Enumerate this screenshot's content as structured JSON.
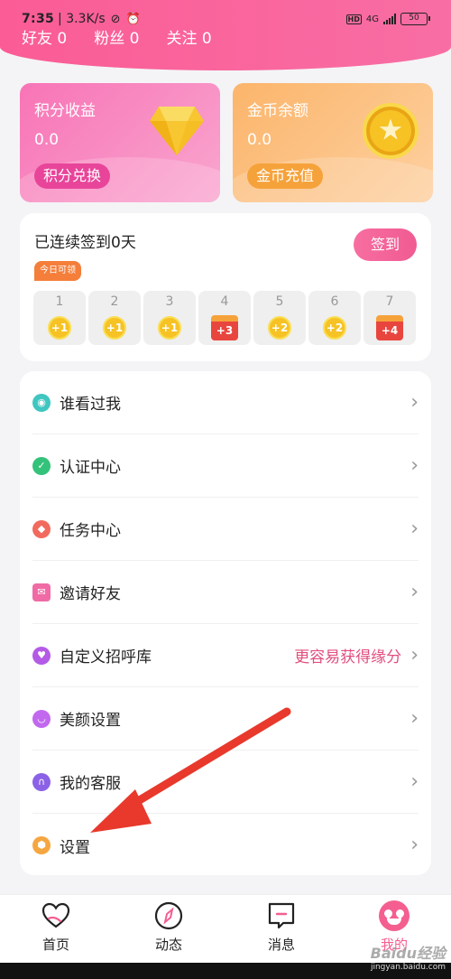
{
  "status_bar": {
    "time": "7:35",
    "network_speed": "3.3K/s",
    "network_type": "4G",
    "hd_badge": "HD",
    "battery": "50"
  },
  "social": {
    "friends": "好友 0",
    "fans": "粉丝 0",
    "following": "关注 0"
  },
  "points_card": {
    "title": "积分收益",
    "value": "0.0",
    "button": "积分兑换"
  },
  "coin_card": {
    "title": "金币余额",
    "value": "0.0",
    "button": "金币充值"
  },
  "checkin": {
    "title": "已连续签到0天",
    "button": "签到",
    "tip": "今日可领",
    "days": [
      {
        "day": "1",
        "reward": "+1",
        "type": "coin"
      },
      {
        "day": "2",
        "reward": "+1",
        "type": "coin"
      },
      {
        "day": "3",
        "reward": "+1",
        "type": "coin"
      },
      {
        "day": "4",
        "reward": "+3",
        "type": "chest"
      },
      {
        "day": "5",
        "reward": "+2",
        "type": "coin"
      },
      {
        "day": "6",
        "reward": "+2",
        "type": "coin"
      },
      {
        "day": "7",
        "reward": "+4",
        "type": "chest"
      }
    ]
  },
  "menu": [
    {
      "label": "谁看过我",
      "icon": "eye-icon",
      "color": "#3fc6c0"
    },
    {
      "label": "认证中心",
      "icon": "shield-check-icon",
      "color": "#33c27a"
    },
    {
      "label": "任务中心",
      "icon": "diamond-task-icon",
      "color": "#f26a5e"
    },
    {
      "label": "邀请好友",
      "icon": "envelope-icon",
      "color": "#f06ba6"
    },
    {
      "label": "自定义招呼库",
      "icon": "heart-chat-icon",
      "color": "#b45be6",
      "extra": "更容易获得缘分"
    },
    {
      "label": "美颜设置",
      "icon": "smile-face-icon",
      "color": "#c268ef"
    },
    {
      "label": "我的客服",
      "icon": "headset-icon",
      "color": "#8b62e6"
    },
    {
      "label": "设置",
      "icon": "gear-hexagon-icon",
      "color": "#f5a640"
    }
  ],
  "tabbar": [
    {
      "label": "首页",
      "icon": "heart-outline-icon"
    },
    {
      "label": "动态",
      "icon": "compass-icon"
    },
    {
      "label": "消息",
      "icon": "chat-bubble-icon"
    },
    {
      "label": "我的",
      "icon": "love-eyes-face-icon"
    }
  ],
  "watermark": {
    "brand": "Baidu经验",
    "url": "jingyan.baidu.com"
  },
  "colors": {
    "accent_pink": "#f65f93",
    "points_pink": "#f874b6",
    "coin_orange": "#fcb56b",
    "annotation_red": "#e8392c"
  }
}
